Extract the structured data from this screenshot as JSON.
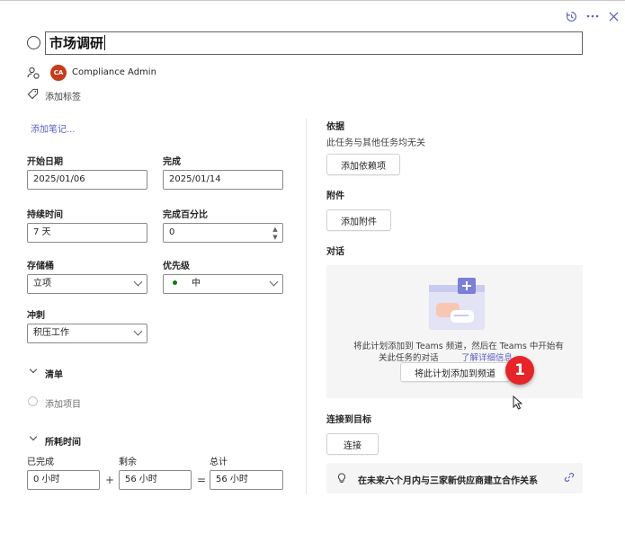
{
  "task": {
    "title": "市场调研",
    "assignee_initials": "CA",
    "assignee_name": "Compliance Admin",
    "add_label": "添加标签",
    "add_notes": "添加笔记..."
  },
  "fields": {
    "start_label": "开始日期",
    "start_value": "2025/01/06",
    "due_label": "完成",
    "due_value": "2025/01/14",
    "duration_label": "持续时间",
    "duration_value": "7 天",
    "percent_label": "完成百分比",
    "percent_value": "0",
    "bucket_label": "存储桶",
    "bucket_value": "立项",
    "priority_label": "优先级",
    "priority_value": "中",
    "sprint_label": "冲刺",
    "sprint_value": "积压工作"
  },
  "checklist": {
    "title": "清单",
    "add_item": "添加项目"
  },
  "effort": {
    "title": "所耗时间",
    "completed_label": "已完成",
    "completed_value": "0 小时",
    "remaining_label": "剩余",
    "remaining_value": "56 小时",
    "total_label": "总计",
    "total_value": "56 小时",
    "plus": "+",
    "equals": "="
  },
  "dependencies": {
    "title": "依据",
    "description": "此任务与其他任务均无关",
    "button": "添加依赖项"
  },
  "attachments": {
    "title": "附件",
    "button": "添加附件"
  },
  "conversation": {
    "title": "对话",
    "message_line1": "将此计划添加到 Teams 频道，然后在 Teams 中开始有",
    "message_line2": "关此任务的对话",
    "learn_more": "了解详细信息",
    "button": "将此计划添加到频道"
  },
  "goals": {
    "title": "连接到目标",
    "button": "连接",
    "goal_text": "在未来六个月内与三家新供应商建立合作关系"
  },
  "annotation": {
    "badge": "1"
  },
  "colors": {
    "accent": "#5b5fc7",
    "avatar": "#c43e1c",
    "priority_dot": "#107c10",
    "badge": "#e5252a"
  }
}
